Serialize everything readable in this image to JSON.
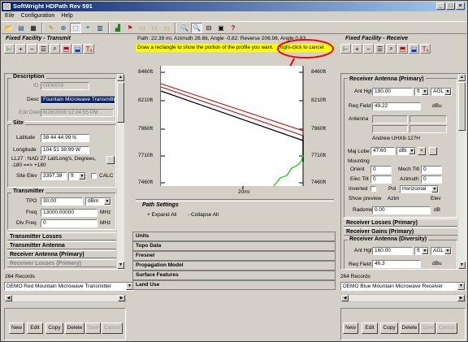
{
  "window": {
    "title": "SoftWright HDPath Rev 591"
  },
  "menu": [
    "Eile",
    "Configuration",
    "Help"
  ],
  "status_info": "Path: 22.39 mi, Azimuth 26.86, Angle -0.82; Reverse 206.98, Angle 0.83",
  "hint": {
    "text": "Draw a rectangle to show the portion of the profile you want.",
    "callout": "Right-click to cancel."
  },
  "left": {
    "section_title": "Fixed Facility - Transmit",
    "description": {
      "title": "Description",
      "id_label": "ID",
      "id_value": "0000076",
      "desc_label": "Desc",
      "desc_value": "Fountain Microwave Transmitter",
      "edit_label": "Edit Date",
      "edit_value": "6/28/2008 12:24:55 PM"
    },
    "site": {
      "title": "Site",
      "lat_label": "Latitude",
      "lat_value": "38 44 44.99 N",
      "lon_label": "Longitude",
      "lon_value": "104 51 38.99 W",
      "datum_text1": "LL27 : NAD 27 Lat/Long's, Degrees,",
      "datum_text2": "-180 ==> +180",
      "elev_label": "Site Elev",
      "elev_value": "3397.38",
      "elev_unit": "ft",
      "calc_label": "CALC"
    },
    "transmitter": {
      "title": "Transmitter",
      "tpo_label": "TPO",
      "tpo_value": "30.00",
      "tpo_unit": "dBm",
      "freq_label": "Freq",
      "freq_value": "13000.00000",
      "freq_unit": "MHz",
      "div_label": "Div Freq",
      "div_value": "0",
      "div_unit": "MHz"
    },
    "collapsed": [
      "Transmitter Losses",
      "Transmitter Antenna",
      "Receiver Antenna (Primary)",
      "Receiver Losses (Primary)"
    ],
    "records": "264 Records",
    "record_select": "DEMO Red Mountain Microwave Transmitter",
    "buttons": [
      "New",
      "Edit",
      "Copy",
      "Delete",
      "Save",
      "Cancel"
    ]
  },
  "right": {
    "section_title": "Fixed Facility - Receive",
    "rx_primary": {
      "title": "Receiver Antenna (Primary)",
      "ant_label": "Ant Hgt",
      "ant_value": "190.00",
      "ant_unit": "ft",
      "ant_ref": "AGL",
      "req_label": "Req Field",
      "req_value": "49.22",
      "req_unit": "dBu",
      "antenna_label": "Antenna",
      "antenna_name": "Andrew UHX8-127H",
      "lobe_label": "Maj Lobe",
      "lobe_value": "47.60",
      "lobe_unit": "dBi",
      "mounting_label": "Mounting",
      "orient_label": "Orient",
      "orient_value": "0",
      "mech_label": "Mech Tilt",
      "mech_value": "0",
      "elec_label": "Elec Tilt",
      "elec_value": "0",
      "azim_label": "Azimuth",
      "azim_value": "0",
      "inverted_label": "Inverted",
      "pol_label": "Pol",
      "pol_value": "Horizontal",
      "preview_label": "Show preview",
      "azim_col": "Azim",
      "elev_col": "Elev",
      "radome_label": "Radome",
      "radome_value": "0.00",
      "radome_unit": "dB"
    },
    "collapsed": [
      "Receiver Losses (Primary)",
      "Receiver Gains (Primary)"
    ],
    "rx_diversity": {
      "title": "Receiver Antenna (Diversity)",
      "ant_label": "Ant Hgt",
      "ant_value": "160.00",
      "ant_unit": "ft",
      "ant_ref": "AGL",
      "req_label": "Req Field",
      "req_value": "46.3",
      "req_unit": "dBu"
    },
    "records": "264 Records",
    "record_select": "DEMO Blue Mountain Microwave Receiver",
    "buttons": [
      "New",
      "Edit",
      "Copy",
      "Delete",
      "Save",
      "Cancel"
    ]
  },
  "profile": {
    "left_ticks": [
      "8460ft",
      "8210ft",
      "7960ft",
      "7710ft",
      "7460ft"
    ],
    "right_ticks": [
      "8460ft",
      "8210ft",
      "7960ft",
      "7710ft",
      "7460ft"
    ],
    "x_label": "20mi"
  },
  "path_settings": {
    "title": "Path Settings",
    "expand": "+ Expand All",
    "collapse": "- Collapse All",
    "items": [
      "Units",
      "Topo Data",
      "Fresnel",
      "Propagation Model",
      "Surface Features",
      "Land Use"
    ]
  },
  "colors": {
    "title_start": "#0a246a",
    "title_end": "#a6caf0",
    "highlight": "#ffff00",
    "callout_red": "#ff0000",
    "terrain": "#00cc00"
  }
}
